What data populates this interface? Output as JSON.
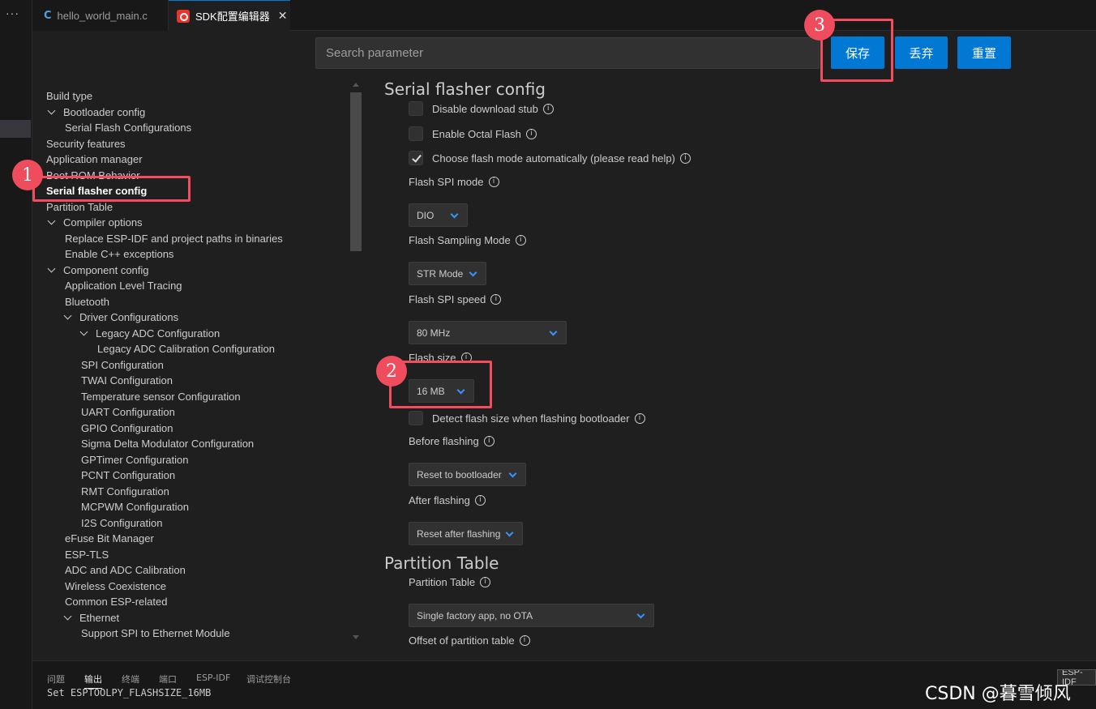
{
  "activity_bar": {
    "more_label": "···"
  },
  "tabs": [
    {
      "icon": "C",
      "label": "hello_world_main.c"
    },
    {
      "label": "SDK配置编辑器",
      "close": "✕"
    }
  ],
  "search": {
    "placeholder": "Search parameter"
  },
  "buttons": {
    "save": "保存",
    "discard": "丢弃",
    "reset": "重置"
  },
  "tree": [
    {
      "label": "Build type",
      "level": 0,
      "chevron": false
    },
    {
      "label": "Bootloader config",
      "level": 0,
      "chevron": true
    },
    {
      "label": "Serial Flash Configurations",
      "level": 1,
      "chevron": false
    },
    {
      "label": "Security features",
      "level": 0,
      "chevron": false
    },
    {
      "label": "Application manager",
      "level": 0,
      "chevron": false
    },
    {
      "label": "Boot ROM Behavior",
      "level": 0,
      "chevron": false
    },
    {
      "label": "Serial flasher config",
      "level": 0,
      "chevron": false,
      "selected": true
    },
    {
      "label": "Partition Table",
      "level": 0,
      "chevron": false
    },
    {
      "label": "Compiler options",
      "level": 0,
      "chevron": true
    },
    {
      "label": "Replace ESP-IDF and project paths in binaries",
      "level": 1,
      "chevron": false
    },
    {
      "label": "Enable C++ exceptions",
      "level": 1,
      "chevron": false
    },
    {
      "label": "Component config",
      "level": 0,
      "chevron": true
    },
    {
      "label": "Application Level Tracing",
      "level": 1,
      "chevron": false
    },
    {
      "label": "Bluetooth",
      "level": 1,
      "chevron": false
    },
    {
      "label": "Driver Configurations",
      "level": 1,
      "chevron": true
    },
    {
      "label": "Legacy ADC Configuration",
      "level": 2,
      "chevron": true
    },
    {
      "label": "Legacy ADC Calibration Configuration",
      "level": 3,
      "chevron": false
    },
    {
      "label": "SPI Configuration",
      "level": 2,
      "chevron": false
    },
    {
      "label": "TWAI Configuration",
      "level": 2,
      "chevron": false
    },
    {
      "label": "Temperature sensor Configuration",
      "level": 2,
      "chevron": false
    },
    {
      "label": "UART Configuration",
      "level": 2,
      "chevron": false
    },
    {
      "label": "GPIO Configuration",
      "level": 2,
      "chevron": false
    },
    {
      "label": "Sigma Delta Modulator Configuration",
      "level": 2,
      "chevron": false
    },
    {
      "label": "GPTimer Configuration",
      "level": 2,
      "chevron": false
    },
    {
      "label": "PCNT Configuration",
      "level": 2,
      "chevron": false
    },
    {
      "label": "RMT Configuration",
      "level": 2,
      "chevron": false
    },
    {
      "label": "MCPWM Configuration",
      "level": 2,
      "chevron": false
    },
    {
      "label": "I2S Configuration",
      "level": 2,
      "chevron": false
    },
    {
      "label": "eFuse Bit Manager",
      "level": 1,
      "chevron": false
    },
    {
      "label": "ESP-TLS",
      "level": 1,
      "chevron": false
    },
    {
      "label": "ADC and ADC Calibration",
      "level": 1,
      "chevron": false
    },
    {
      "label": "Wireless Coexistence",
      "level": 1,
      "chevron": false
    },
    {
      "label": "Common ESP-related",
      "level": 1,
      "chevron": false
    },
    {
      "label": "Ethernet",
      "level": 1,
      "chevron": true
    },
    {
      "label": "Support SPI to Ethernet Module",
      "level": 2,
      "chevron": false
    }
  ],
  "settings": {
    "serial_flasher": {
      "title": "Serial flasher config",
      "disable_download_stub": {
        "label": "Disable download stub",
        "checked": false
      },
      "enable_octal_flash": {
        "label": "Enable Octal Flash",
        "checked": false
      },
      "auto_flash_mode": {
        "label": "Choose flash mode automatically (please read help)",
        "checked": true
      },
      "flash_spi_mode": {
        "label": "Flash SPI mode",
        "value": "DIO"
      },
      "flash_sampling_mode": {
        "label": "Flash Sampling Mode",
        "value": "STR Mode"
      },
      "flash_spi_speed": {
        "label": "Flash SPI speed",
        "value": "80 MHz"
      },
      "flash_size": {
        "label": "Flash size",
        "value": "16 MB"
      },
      "detect_flash_size": {
        "label": "Detect flash size when flashing bootloader",
        "checked": false
      },
      "before_flashing": {
        "label": "Before flashing",
        "value": "Reset to bootloader"
      },
      "after_flashing": {
        "label": "After flashing",
        "value": "Reset after flashing"
      }
    },
    "partition_table": {
      "title": "Partition Table",
      "partition_table": {
        "label": "Partition Table",
        "value": "Single factory app, no OTA"
      },
      "offset": {
        "label": "Offset of partition table"
      }
    }
  },
  "info_glyph": "i",
  "bottom_panel": {
    "tabs": [
      "问题",
      "输出",
      "终端",
      "端口",
      "ESP-IDF",
      "调试控制台"
    ],
    "active_tab": "输出",
    "console_line": "Set ESPTOOLPY_FLASHSIZE_16MB",
    "badge": "ESP-IDF"
  },
  "watermark": "CSDN @暮雪倾风",
  "annotations": [
    {
      "number": "1",
      "target": "Serial flasher config"
    },
    {
      "number": "2",
      "target": "Flash size"
    },
    {
      "number": "3",
      "target": "保存"
    }
  ],
  "colors": {
    "accent": "#0078d4",
    "annotation": "#f24c5e",
    "background": "#1f1f1f"
  }
}
